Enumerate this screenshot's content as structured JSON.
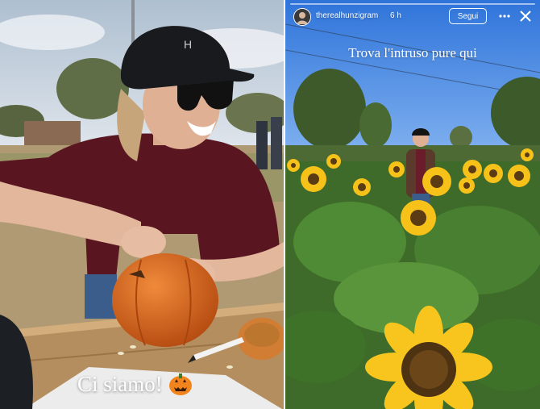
{
  "left_story": {
    "caption": "Ci siamo!",
    "emoji_icon": "jack-o-lantern-icon"
  },
  "right_story": {
    "header": {
      "username": "therealhunzigram",
      "time_ago": "6 h",
      "follow_label": "Segui",
      "more_icon": "more-dots-icon",
      "close_icon": "close-icon"
    },
    "caption": "Trova l'intruso pure qui"
  },
  "colors": {
    "sky_left": "#c9d6e3",
    "sky_right": "#4d8fe6",
    "sunflower_petal": "#f6c21a",
    "pumpkin": "#d9661b",
    "sweater": "#5a1620"
  }
}
